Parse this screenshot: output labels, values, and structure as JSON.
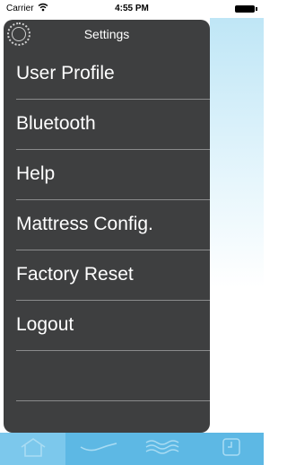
{
  "status_bar": {
    "carrier": "Carrier",
    "time": "4:55 PM"
  },
  "drawer": {
    "title": "Settings",
    "header_icon": "settings-icon",
    "items": [
      {
        "label": "User Profile"
      },
      {
        "label": "Bluetooth"
      },
      {
        "label": "Help"
      },
      {
        "label": "Mattress Config."
      },
      {
        "label": "Factory Reset"
      },
      {
        "label": "Logout"
      }
    ]
  },
  "tab_bar": {
    "tabs": [
      {
        "icon": "home-icon",
        "active": true
      },
      {
        "icon": "wave-icon",
        "active": false
      },
      {
        "icon": "waves-icon",
        "active": false
      },
      {
        "icon": "clock-icon",
        "active": false
      }
    ]
  },
  "colors": {
    "drawer_bg": "#3e3f40",
    "tab_bar_bg": "#5db8e4",
    "tab_active_bg": "#7cc8ec",
    "icon_color": "#a9dcf3"
  }
}
